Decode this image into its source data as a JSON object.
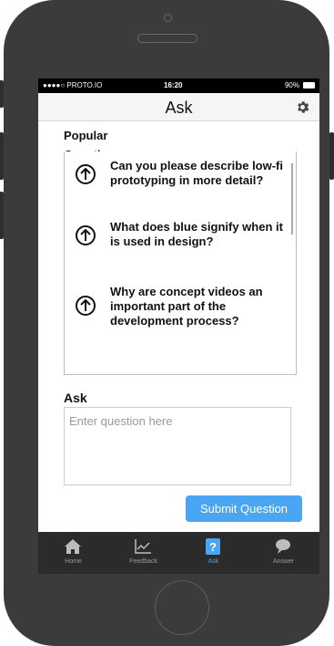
{
  "status_bar": {
    "carrier": "●●●●○ PROTO.IO",
    "time": "16:20",
    "battery": "90%"
  },
  "nav": {
    "title": "Ask",
    "settings_icon": "gear-icon"
  },
  "popular": {
    "title": "Popular Questions",
    "questions": [
      {
        "text": "Can you please describe low-fi prototyping in more detail?"
      },
      {
        "text": "What does blue signify when it is used in design?"
      },
      {
        "text": "Why are concept videos an important part of the development process?"
      }
    ]
  },
  "ask_form": {
    "label": "Ask",
    "placeholder": "Enter question here",
    "value": "",
    "submit_label": "Submit Question"
  },
  "tabs": [
    {
      "label": "Home",
      "icon": "home-icon"
    },
    {
      "label": "Feedback",
      "icon": "chart-icon"
    },
    {
      "label": "Ask",
      "icon": "question-icon",
      "active": true
    },
    {
      "label": "Answer",
      "icon": "speech-bubble-icon"
    }
  ],
  "colors": {
    "accent": "#4aa6f2",
    "phone_body": "#3b3b3b",
    "tab_bar": "#2b2b2b"
  }
}
